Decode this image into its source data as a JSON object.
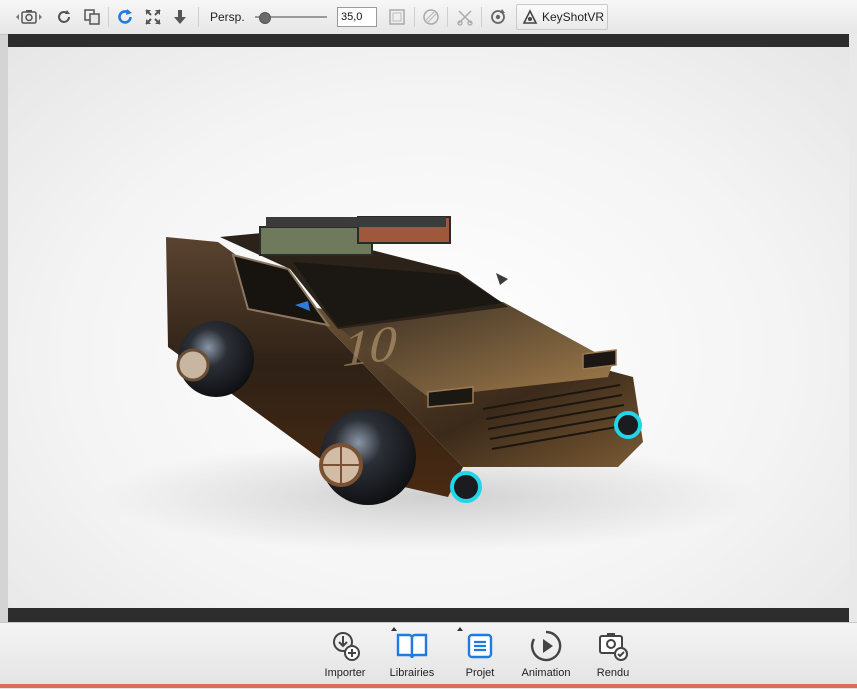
{
  "toolbar": {
    "persp_label": "Persp.",
    "persp_value": "35,0",
    "keyshot_label": "KeyShotVR"
  },
  "viewport": {
    "decal_number": "10"
  },
  "dock": {
    "items": [
      {
        "label": "Importer",
        "icon": "import-icon"
      },
      {
        "label": "Librairies",
        "icon": "book-icon"
      },
      {
        "label": "Projet",
        "icon": "project-icon"
      },
      {
        "label": "Animation",
        "icon": "play-icon"
      },
      {
        "label": "Rendu",
        "icon": "render-icon"
      }
    ]
  },
  "colors": {
    "accent_blue": "#1e7be0",
    "viewport_border": "#2d2d2d",
    "car_body": "#3b2a1a",
    "light_bar_green": "#6f7a5c",
    "light_bar_red": "#a0583a",
    "wheel_glow": "#21d6e8"
  }
}
